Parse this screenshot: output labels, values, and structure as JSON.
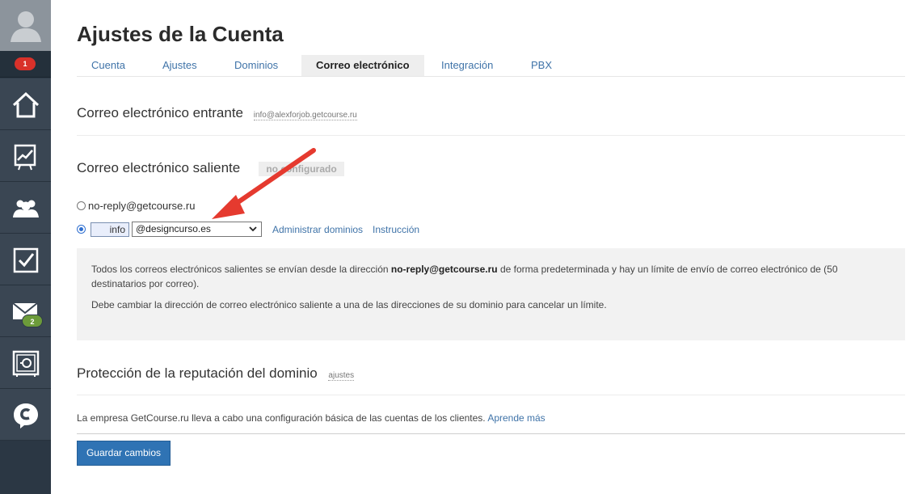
{
  "sidebar": {
    "notifications_badge": "1",
    "messages_badge": "2",
    "items": [
      {
        "icon": "home-icon"
      },
      {
        "icon": "chart-icon"
      },
      {
        "icon": "users-icon"
      },
      {
        "icon": "tasks-icon"
      },
      {
        "icon": "mail-icon"
      },
      {
        "icon": "safe-icon"
      },
      {
        "icon": "chat-icon"
      }
    ]
  },
  "header": {
    "title": "Ajustes de la Cuenta"
  },
  "tabs": [
    {
      "label": "Cuenta"
    },
    {
      "label": "Ajustes"
    },
    {
      "label": "Dominios"
    },
    {
      "label": "Correo electrónico"
    },
    {
      "label": "Integración"
    },
    {
      "label": "PBX"
    }
  ],
  "incoming": {
    "title": "Correo electrónico entrante",
    "address": "info@alexforjob.getcourse.ru"
  },
  "outgoing": {
    "title": "Correo electrónico saliente",
    "status": "no configurado",
    "option_default": "no-reply@getcourse.ru",
    "local_part": "info",
    "domain_selected": "@designcurso.es",
    "manage_domains": "Administrar dominios",
    "instructions": "Instrucción"
  },
  "info": {
    "line1_prefix": "Todos los correos electrónicos salientes se envían desde la dirección ",
    "line1_bold": "no-reply@getcourse.ru",
    "line1_suffix": " de forma predeterminada y hay un límite de envío de correo electrónico de (50 destinatarios por correo).",
    "line2": "Debe cambiar la dirección de correo electrónico saliente a una de las direcciones de su dominio para cancelar un límite."
  },
  "reputation": {
    "title": "Protección de la reputación del dominio",
    "settings_link": "ajustes"
  },
  "footer": {
    "text": "La empresa GetCourse.ru lleva a cabo una configuración básica de las cuentas de los clientes. ",
    "learn_more": "Aprende más"
  },
  "save_label": "Guardar cambios",
  "colors": {
    "sidebar_bg": "#2e3b48",
    "link": "#3f73a8",
    "primary_button": "#2f73b4",
    "annotation_arrow": "#e53a2f"
  }
}
